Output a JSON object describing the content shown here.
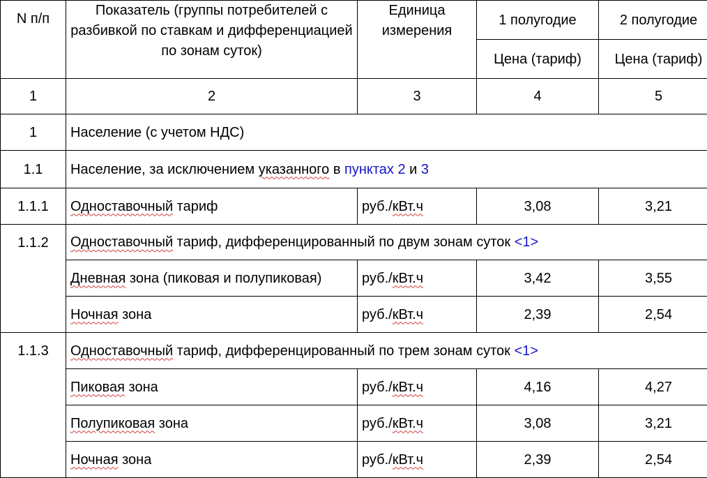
{
  "header": {
    "col1": "N п/п",
    "col2": "Показатель (группы потребителей с разбивкой по ставкам и дифференциацией по зонам суток)",
    "col3": "Единица измерения",
    "col4": "1 полугодие",
    "col5": "2 полугодие",
    "price4": "Цена (тариф)",
    "price5": "Цена (тариф)"
  },
  "numbers_row": [
    "1",
    "2",
    "3",
    "4",
    "5"
  ],
  "rows": {
    "r1": {
      "num": "1",
      "label": "Население (с учетом НДС)"
    },
    "r11": {
      "num": "1.1",
      "label_start": "Население, за исключением ",
      "label_word": "указанного",
      "label_in": " в ",
      "link1": "пунктах 2",
      "label_and": " и ",
      "link2": "3"
    },
    "r111": {
      "num": "1.1.1",
      "label_sq": "Одноставочный",
      "label_rest": " тариф",
      "unit_a": "руб./",
      "unit_b": "кВт.ч",
      "v1": "3,08",
      "v2": "3,21"
    },
    "r112": {
      "num": "1.1.2",
      "label_sq": "Одноставочный",
      "label_rest": " тариф, дифференцированный по двум зонам суток ",
      "link": "<1>",
      "zones": [
        {
          "label_sq": "Дневная",
          "label_rest": " зона (пиковая и полупиковая)",
          "unit_a": "руб./",
          "unit_b": "кВт.ч",
          "v1": "3,42",
          "v2": "3,55"
        },
        {
          "label_sq": "Ночная",
          "label_rest": " зона",
          "unit_a": "руб./",
          "unit_b": "кВт.ч",
          "v1": "2,39",
          "v2": "2,54"
        }
      ]
    },
    "r113": {
      "num": "1.1.3",
      "label_sq": "Одноставочный",
      "label_rest": " тариф, дифференцированный по трем зонам суток ",
      "link": "<1>",
      "zones": [
        {
          "label_sq": "Пиковая",
          "label_rest": " зона",
          "unit_a": "руб./",
          "unit_b": "кВт.ч",
          "v1": "4,16",
          "v2": "4,27"
        },
        {
          "label_sq": "Полупиковая",
          "label_rest": " зона",
          "unit_a": "руб./",
          "unit_b": "кВт.ч",
          "v1": "3,08",
          "v2": "3,21"
        },
        {
          "label_sq": "Ночная",
          "label_rest": " зона",
          "unit_a": "руб./",
          "unit_b": "кВт.ч",
          "v1": "2,39",
          "v2": "2,54"
        }
      ]
    }
  }
}
